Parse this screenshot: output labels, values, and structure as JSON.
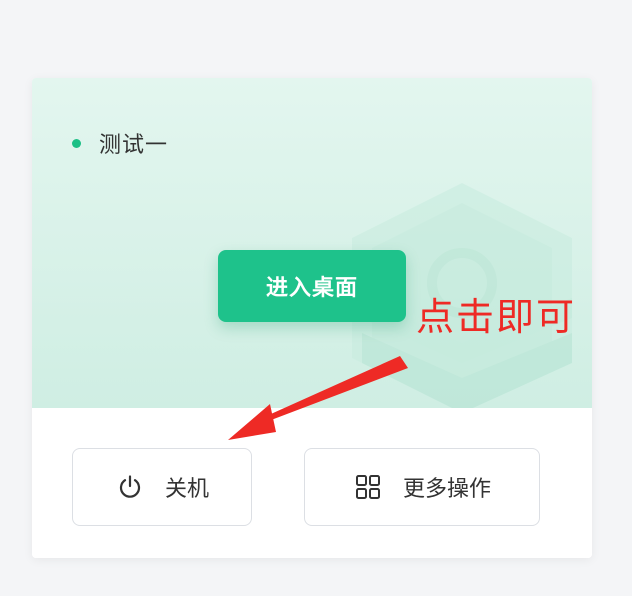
{
  "desktop": {
    "name": "测试一",
    "status_color": "#1bbf85"
  },
  "buttons": {
    "enter_desktop": "进入桌面",
    "shutdown": "关机",
    "more_actions": "更多操作"
  },
  "icons": {
    "shutdown": "power-icon",
    "more_actions": "grid-icon"
  },
  "annotation": {
    "text": "点击即可",
    "color": "#ee2a25"
  },
  "colors": {
    "accent": "#1ec28b",
    "preview_bg": "#dff4ec"
  }
}
